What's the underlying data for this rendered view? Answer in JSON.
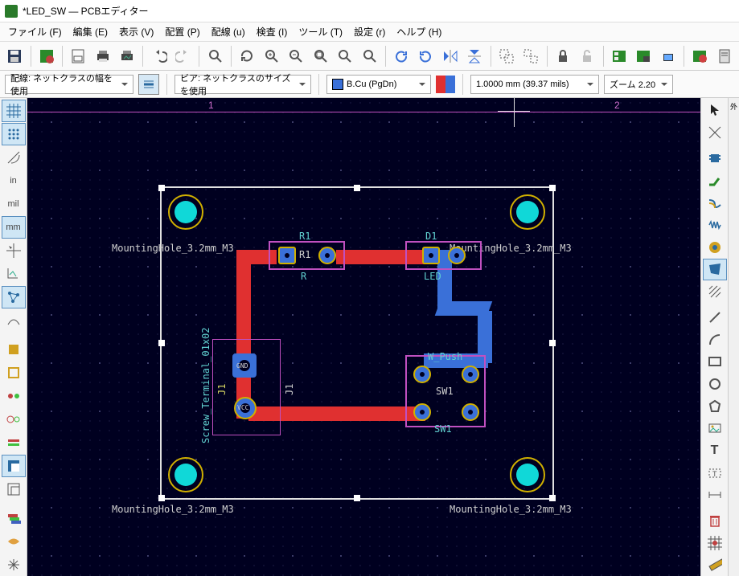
{
  "window": {
    "title": "*LED_SW — PCBエディター"
  },
  "menu": {
    "file": "ファイル (F)",
    "edit": "編集 (E)",
    "view": "表示 (V)",
    "place": "配置 (P)",
    "route": "配線 (u)",
    "inspect": "検査 (I)",
    "tools": "ツール (T)",
    "settings": "設定 (r)",
    "help": "ヘルプ (H)"
  },
  "options": {
    "track": "配線: ネットクラスの幅を使用",
    "via": "ビア: ネットクラスのサイズを使用",
    "layer": "B.Cu (PgDn)",
    "grid": "1.0000 mm (39.37 mils)",
    "zoom": "ズーム 2.20"
  },
  "left_tools": {
    "in": "in",
    "mil": "mil",
    "mm": "mm"
  },
  "ruler": {
    "t1": "1",
    "t2": "2"
  },
  "board": {
    "outline_layer": "Edge.Cuts",
    "mounting_holes": {
      "label": "MountingHole_3.2mm_M3"
    },
    "r1": {
      "ref": "R1",
      "val": "R",
      "ref_silk": "R1"
    },
    "d1": {
      "ref": "D1",
      "val": "LED"
    },
    "sw1": {
      "ref": "SW1",
      "val": "SW1",
      "fp": "W_Push"
    },
    "j1": {
      "ref": "J1",
      "fp": "Screw_Terminal_01x02",
      "p1": "GND",
      "p2": "VCC"
    }
  },
  "right_extra": "外"
}
